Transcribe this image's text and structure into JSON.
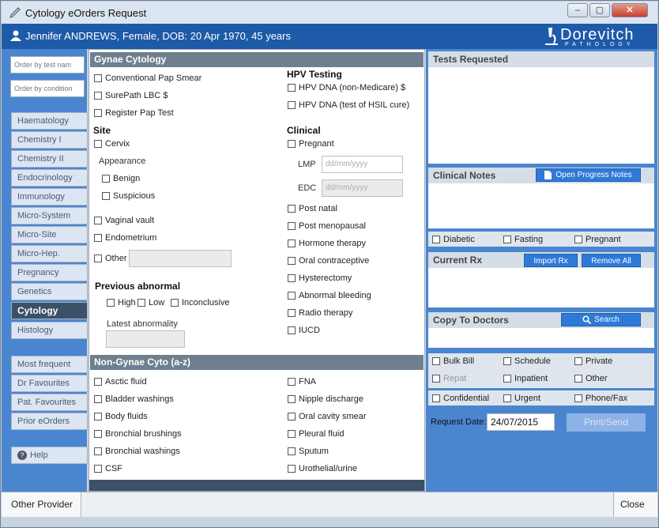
{
  "window": {
    "title": "Cytology eOrders Request",
    "controls": [
      "minimize",
      "maximize",
      "close"
    ]
  },
  "patient": {
    "text": "Jennifer ANDREWS, Female, DOB: 20 Apr 1970, 45 years"
  },
  "logo": {
    "name": "Dorevitch",
    "sub": "PATHOLOGY"
  },
  "sidebar": {
    "filter_test_placeholder": "Order by test nam",
    "filter_condition_placeholder": "Order by condition",
    "tabs": [
      "Haematology",
      "Chemistry I",
      "Chemistry II",
      "Endocrinology",
      "Immunology",
      "Micro-System",
      "Micro-Site",
      "Micro-Hep.",
      "Pregnancy",
      "Genetics",
      "Cytology",
      "Histology"
    ],
    "active_tab": "Cytology",
    "lists": [
      "Most frequent",
      "Dr Favourites",
      "Pat. Favourites",
      "Prior eOrders"
    ],
    "help": "Help"
  },
  "gynae": {
    "title": "Gynae Cytology",
    "tests": [
      "Conventional Pap Smear",
      "SurePath LBC $",
      "Register Pap Test"
    ],
    "hpv_title": "HPV Testing",
    "hpv": [
      "HPV DNA (non-Medicare) $",
      "HPV DNA (test of HSIL cure)"
    ],
    "site_title": "Site",
    "cervix": "Cervix",
    "appearance": "Appearance",
    "benign": "Benign",
    "suspicious": "Suspicious",
    "vaginal_vault": "Vaginal vault",
    "endometrium": "Endometrium",
    "other": "Other",
    "prev_title": "Previous abnormal",
    "high": "High",
    "low": "Low",
    "inconclusive": "Inconclusive",
    "latest": "Latest abnormality",
    "clinical_title": "Clinical",
    "pregnant": "Pregnant",
    "lmp": "LMP",
    "edc": "EDC",
    "date_placeholder": "dd/mm/yyyy",
    "clinical": [
      "Post natal",
      "Post menopausal",
      "Hormone therapy",
      "Oral contraceptive",
      "Hysterectomy",
      "Abnormal bleeding",
      "Radio therapy",
      "IUCD"
    ]
  },
  "nongynae": {
    "title": "Non-Gynae Cyto (a-z)",
    "left": [
      "Asctic fluid",
      "Bladder washings",
      "Body fluids",
      "Bronchial brushings",
      "Bronchial washings",
      "CSF"
    ],
    "right": [
      "FNA",
      "Nipple discharge",
      "Oral cavity smear",
      "Pleural fluid",
      "Sputum",
      "Urothelial/urine"
    ]
  },
  "right": {
    "tests_requested": "Tests Requested",
    "clinical_notes": "Clinical Notes",
    "open_progress_notes": "Open Progress Notes",
    "diabetic": "Diabetic",
    "fasting": "Fasting",
    "pregnant": "Pregnant",
    "current_rx": "Current Rx",
    "import_rx": "Import Rx",
    "remove_all": "Remove All",
    "copy_to_doctors": "Copy To Doctors",
    "search": "Search",
    "bulk_bill": "Bulk Bill",
    "schedule": "Schedule",
    "private": "Private",
    "repat": "Repat",
    "inpatient": "Inpatient",
    "other": "Other",
    "confidential": "Confidential",
    "urgent": "Urgent",
    "phone_fax": "Phone/Fax",
    "request_date_label": "Request Date:",
    "request_date": "24/07/2015",
    "print_send": "Print/Send"
  },
  "status": {
    "other_provider": "Other Provider",
    "close": "Close"
  }
}
